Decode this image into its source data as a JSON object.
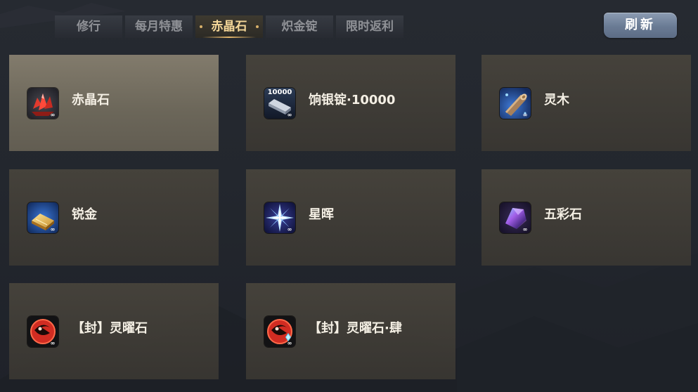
{
  "tabs": [
    {
      "label": "修行"
    },
    {
      "label": "每月特惠"
    },
    {
      "label": "赤晶石"
    },
    {
      "label": "炽金锭"
    },
    {
      "label": "限时返利"
    }
  ],
  "active_tab_index": 2,
  "refresh_label": "刷新",
  "items": [
    {
      "name": "赤晶石",
      "icon": "red-crystal-icon",
      "badge": "∞",
      "selected": true
    },
    {
      "name": "饷银锭·10000",
      "icon": "silver-ingot-icon",
      "icon_text": "10000",
      "badge": "∞"
    },
    {
      "name": "灵木",
      "icon": "spirit-wood-icon",
      "badge": "∞"
    },
    {
      "name": "锐金",
      "icon": "gold-bar-icon",
      "badge": "∞"
    },
    {
      "name": "星晖",
      "icon": "star-radiance-icon",
      "badge": "∞"
    },
    {
      "name": "五彩石",
      "icon": "five-color-stone-icon",
      "badge": "∞"
    },
    {
      "name": "【封】灵曜石",
      "icon": "sealed-spirit-stone-icon",
      "badge": "∞"
    },
    {
      "name": "【封】灵曜石·肆",
      "icon": "sealed-spirit-stone-four-icon",
      "badge": "∞"
    }
  ],
  "colors": {
    "active_tab_text": "#f6d89a",
    "refresh_button": "#7585a0",
    "card_bg": "#48443c",
    "card_selected_bg": "#7a7466"
  }
}
